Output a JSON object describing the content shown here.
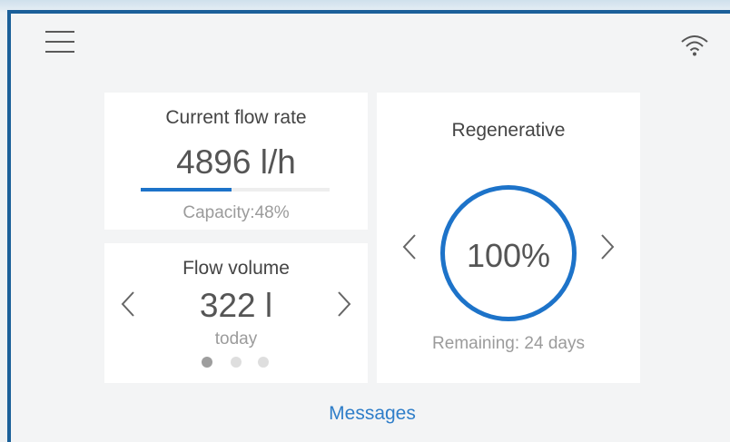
{
  "flow_rate": {
    "title": "Current flow rate",
    "value": "4896 l/h",
    "capacity_label": "Capacity:48%",
    "capacity_fraction": 0.48,
    "accent": "#1d73c9"
  },
  "flow_volume": {
    "title": "Flow volume",
    "value": "322 l",
    "period": "today",
    "pages_total": 3,
    "page_active": 1
  },
  "regeneration": {
    "title": "Regenerative",
    "percent": "100%",
    "remaining": "Remaining: 24 days"
  },
  "footer": {
    "messages_label": "Messages"
  },
  "icons": {
    "menu": "hamburger-menu-icon",
    "wifi": "wifi-icon",
    "prev": "chevron-left-icon",
    "next": "chevron-right-icon"
  }
}
